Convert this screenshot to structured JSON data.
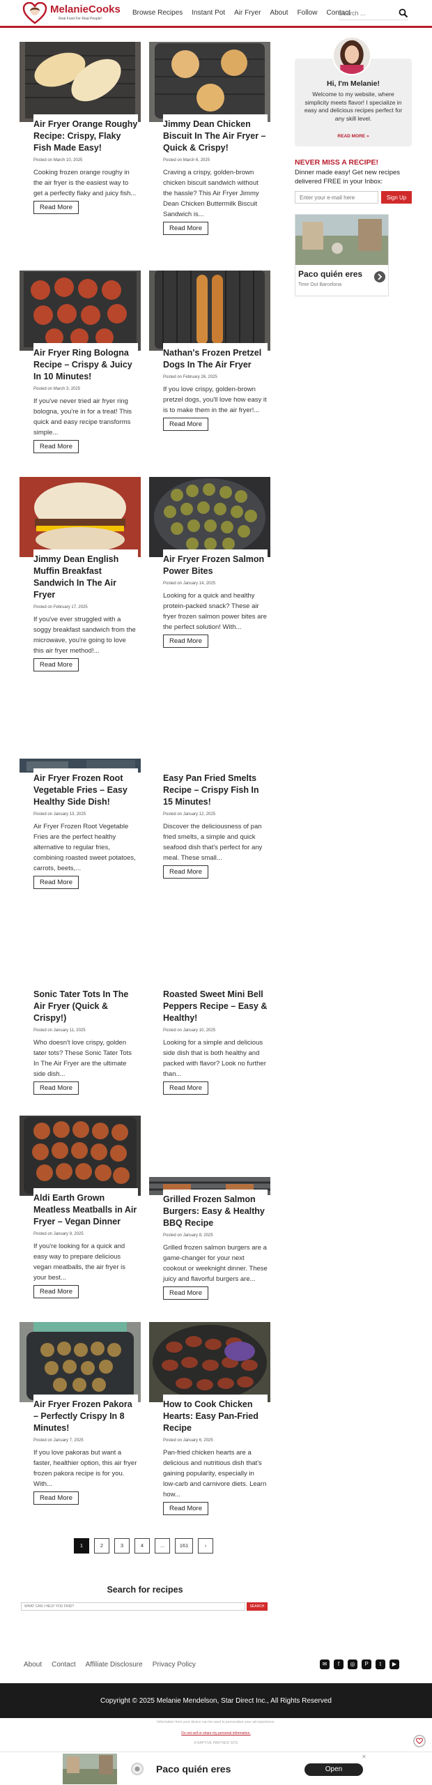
{
  "header": {
    "logo_name": "MelanieCooks",
    "logo_tagline": "Real Food For Real People!",
    "nav": [
      "Browse Recipes",
      "Instant Pot",
      "Air Fryer",
      "About",
      "Follow",
      "Contact"
    ],
    "search_placeholder": "Search ..."
  },
  "posts": [
    {
      "title": "Air Fryer Orange Roughy Recipe: Crispy, Flaky Fish Made Easy!",
      "date": "Posted on March 10, 2025",
      "excerpt": "Cooking frozen orange roughy in the air fryer is the easiest way to get a perfectly flaky and juicy fish...",
      "read_more": "Read More"
    },
    {
      "title": "Jimmy Dean Chicken Biscuit In The Air Fryer – Quick & Crispy!",
      "date": "Posted on March 6, 2025",
      "excerpt": "Craving a crispy, golden-brown chicken biscuit sandwich without the hassle? This Air Fryer Jimmy Dean Chicken Buttermilk Biscuit Sandwich is...",
      "read_more": "Read More"
    },
    {
      "title": "Air Fryer Ring Bologna Recipe – Crispy & Juicy In 10 Minutes!",
      "date": "Posted on March 3, 2025",
      "excerpt": "If you've never tried air fryer ring bologna, you're in for a treat! This quick and easy recipe transforms simple...",
      "read_more": "Read More"
    },
    {
      "title": "Nathan's Frozen Pretzel Dogs In The Air Fryer",
      "date": "Posted on February 26, 2025",
      "excerpt": "If you love crispy, golden-brown pretzel dogs, you'll love how easy it is to make them in the air fryer!...",
      "read_more": "Read More"
    },
    {
      "title": "Jimmy Dean English Muffin Breakfast Sandwich In The Air Fryer",
      "date": "Posted on February 17, 2025",
      "excerpt": "If you've ever struggled with a soggy breakfast sandwich from the microwave, you're going to love this air fryer method!...",
      "read_more": "Read More"
    },
    {
      "title": "Air Fryer Frozen Salmon Power Bites",
      "date": "Posted on January 14, 2025",
      "excerpt": "Looking for a quick and healthy protein-packed snack? These air fryer frozen salmon power bites are the perfect solution! With...",
      "read_more": "Read More"
    },
    {
      "title": "Air Fryer Frozen Root Vegetable Fries – Easy Healthy Side Dish!",
      "date": "Posted on January 13, 2025",
      "excerpt": "Air Fryer Frozen Root Vegetable Fries are the perfect healthy alternative to regular fries, combining roasted sweet potatoes, carrots, beets,...",
      "read_more": "Read More"
    },
    {
      "title": "Easy Pan Fried Smelts Recipe – Crispy Fish In 15 Minutes!",
      "date": "Posted on January 12, 2025",
      "excerpt": "Discover the deliciousness of pan fried smelts, a simple and quick seafood dish that's perfect for any meal. These small...",
      "read_more": "Read More"
    },
    {
      "title": "Sonic Tater Tots In The Air Fryer (Quick & Crispy!)",
      "date": "Posted on January 11, 2025",
      "excerpt": "Who doesn't love crispy, golden tater tots? These Sonic Tater Tots In The Air Fryer are the ultimate side dish...",
      "read_more": "Read More"
    },
    {
      "title": "Roasted Sweet Mini Bell Peppers Recipe – Easy & Healthy!",
      "date": "Posted on January 10, 2025",
      "excerpt": "Looking for a simple and delicious side dish that is both healthy and packed with flavor? Look no further than...",
      "read_more": "Read More"
    },
    {
      "title": "Aldi Earth Grown Meatless Meatballs in Air Fryer – Vegan Dinner",
      "date": "Posted on January 9, 2025",
      "excerpt": "If you're looking for a quick and easy way to prepare delicious vegan meatballs, the air fryer is your best...",
      "read_more": "Read More"
    },
    {
      "title": "Grilled Frozen Salmon Burgers: Easy & Healthy BBQ Recipe",
      "date": "Posted on January 8, 2025",
      "excerpt": "Grilled frozen salmon burgers are a game-changer for your next cookout or weeknight dinner. These juicy and flavorful burgers are...",
      "read_more": "Read More"
    },
    {
      "title": "Air Fryer Frozen Pakora – Perfectly Crispy In 8 Minutes!",
      "date": "Posted on January 7, 2025",
      "excerpt": "If you love pakoras but want a faster, healthier option, this air fryer frozen pakora recipe is for you. With...",
      "read_more": "Read More"
    },
    {
      "title": "How to Cook Chicken Hearts: Easy Pan-Fried Recipe",
      "date": "Posted on January 6, 2025",
      "excerpt": "Pan-fried chicken hearts are a delicious and nutritious dish that's gaining popularity, especially in low-carb and carnivore diets. Learn how...",
      "read_more": "Read More"
    }
  ],
  "sidebar": {
    "greeting": "Hi, I'm Melanie!",
    "about": "Welcome to my website, where simplicity meets flavor! I specialize in easy and delicious recipes perfect for any skill level.",
    "read_more": "READ MORE »",
    "newsletter_title": "NEVER MISS A RECIPE!",
    "newsletter_text": "Dinner made easy! Get new recipes delivered FREE in your Inbox:",
    "email_placeholder": "Enter your e-mail here",
    "signup": "Sign Up",
    "ad_title": "Paco quién eres",
    "ad_sub": "Time Out Barcelona"
  },
  "pagination": [
    "1",
    "2",
    "3",
    "4",
    "...",
    "161",
    "›"
  ],
  "search": {
    "title": "Search for recipes",
    "placeholder": "WHAT CAN I HELP YOU FIND?",
    "button": "SEARCH"
  },
  "footer": {
    "links": [
      "About",
      "Contact",
      "Affiliate Disclosure",
      "Privacy Policy"
    ],
    "socials": [
      "email-icon",
      "facebook-icon",
      "instagram-icon",
      "pinterest-icon",
      "twitter-icon",
      "youtube-icon"
    ],
    "copyright": "Copyright © 2025 Melanie Mendelson, Star Direct Inc., All Rights Reserved",
    "legal1": "Information from your device can be used to personalize your ad experience.",
    "legal2": "Do not sell or share my personal information.",
    "legal3": "A RAPTIVE PARTNER SITE"
  },
  "bottom_ad": {
    "title": "Paco quién eres",
    "open": "Open"
  },
  "colors": {
    "brand": "#b91c2c",
    "signup": "#d12a2a"
  }
}
